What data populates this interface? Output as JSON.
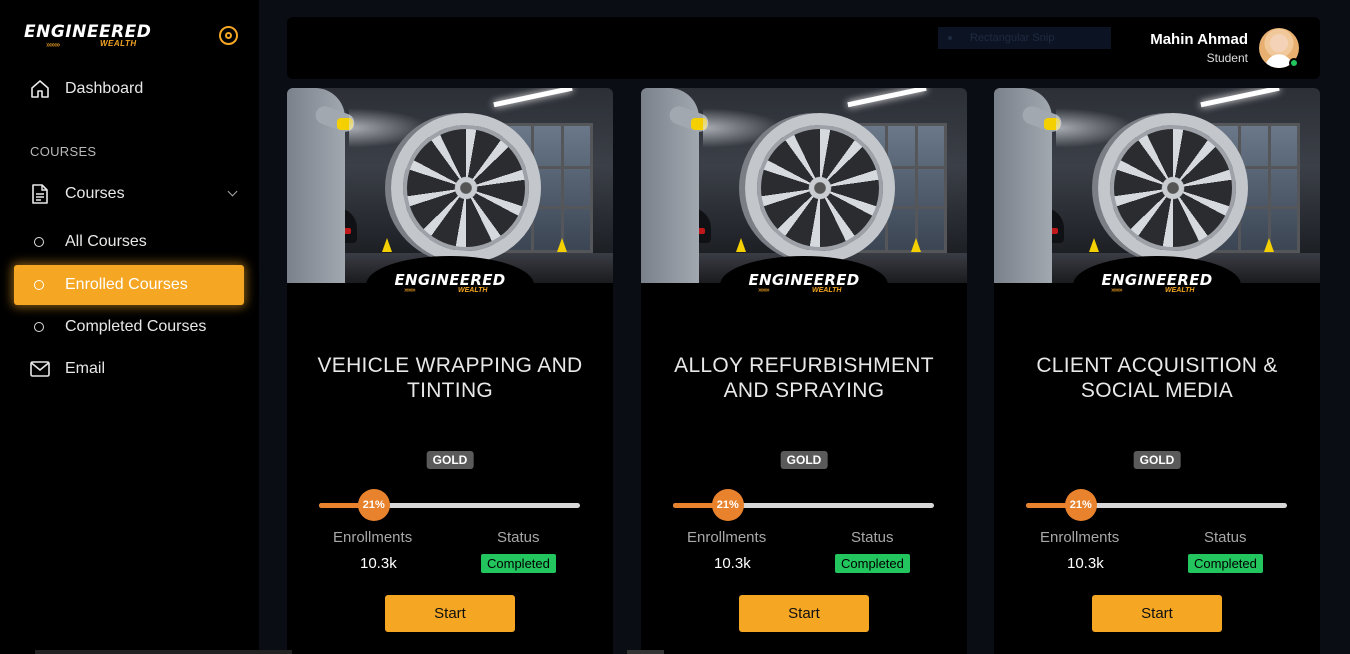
{
  "sidebar": {
    "logo_word": "ENGINEERED",
    "logo_sub": "WEALTH",
    "items": [
      {
        "label": "Dashboard",
        "icon": "home-icon"
      },
      {
        "label": "Courses",
        "icon": "document-icon"
      },
      {
        "label": "All Courses"
      },
      {
        "label": "Enrolled Courses",
        "active": true
      },
      {
        "label": "Completed Courses"
      },
      {
        "label": "Email",
        "icon": "mail-icon"
      }
    ],
    "section_label": "COURSES"
  },
  "header": {
    "snip_text": "Rectangular Snip",
    "user_name": "Mahin Ahmad",
    "user_role": "Student"
  },
  "cards": [
    {
      "title": "VEHICLE WRAPPING AND TINTING",
      "tier": "GOLD",
      "progress": 21,
      "progress_label": "21%",
      "enroll_label": "Enrollments",
      "enroll_value": "10.3k",
      "status_label": "Status",
      "status_value": "Completed",
      "button": "Start",
      "image_logo": "ENGINEERED",
      "image_logo_sub": "WEALTH"
    },
    {
      "title": "ALLOY REFURBISHMENT AND SPRAYING",
      "tier": "GOLD",
      "progress": 21,
      "progress_label": "21%",
      "enroll_label": "Enrollments",
      "enroll_value": "10.3k",
      "status_label": "Status",
      "status_value": "Completed",
      "button": "Start",
      "image_logo": "ENGINEERED",
      "image_logo_sub": "WEALTH"
    },
    {
      "title": "CLIENT ACQUISITION & SOCIAL MEDIA",
      "tier": "GOLD",
      "progress": 21,
      "progress_label": "21%",
      "enroll_label": "Enrollments",
      "enroll_value": "10.3k",
      "status_label": "Status",
      "status_value": "Completed",
      "button": "Start",
      "image_logo": "ENGINEERED",
      "image_logo_sub": "WEALTH"
    }
  ],
  "colors": {
    "accent": "#f5a623",
    "progress": "#e8822c",
    "status": "#22c55e",
    "tier": "#5a5a5a"
  }
}
